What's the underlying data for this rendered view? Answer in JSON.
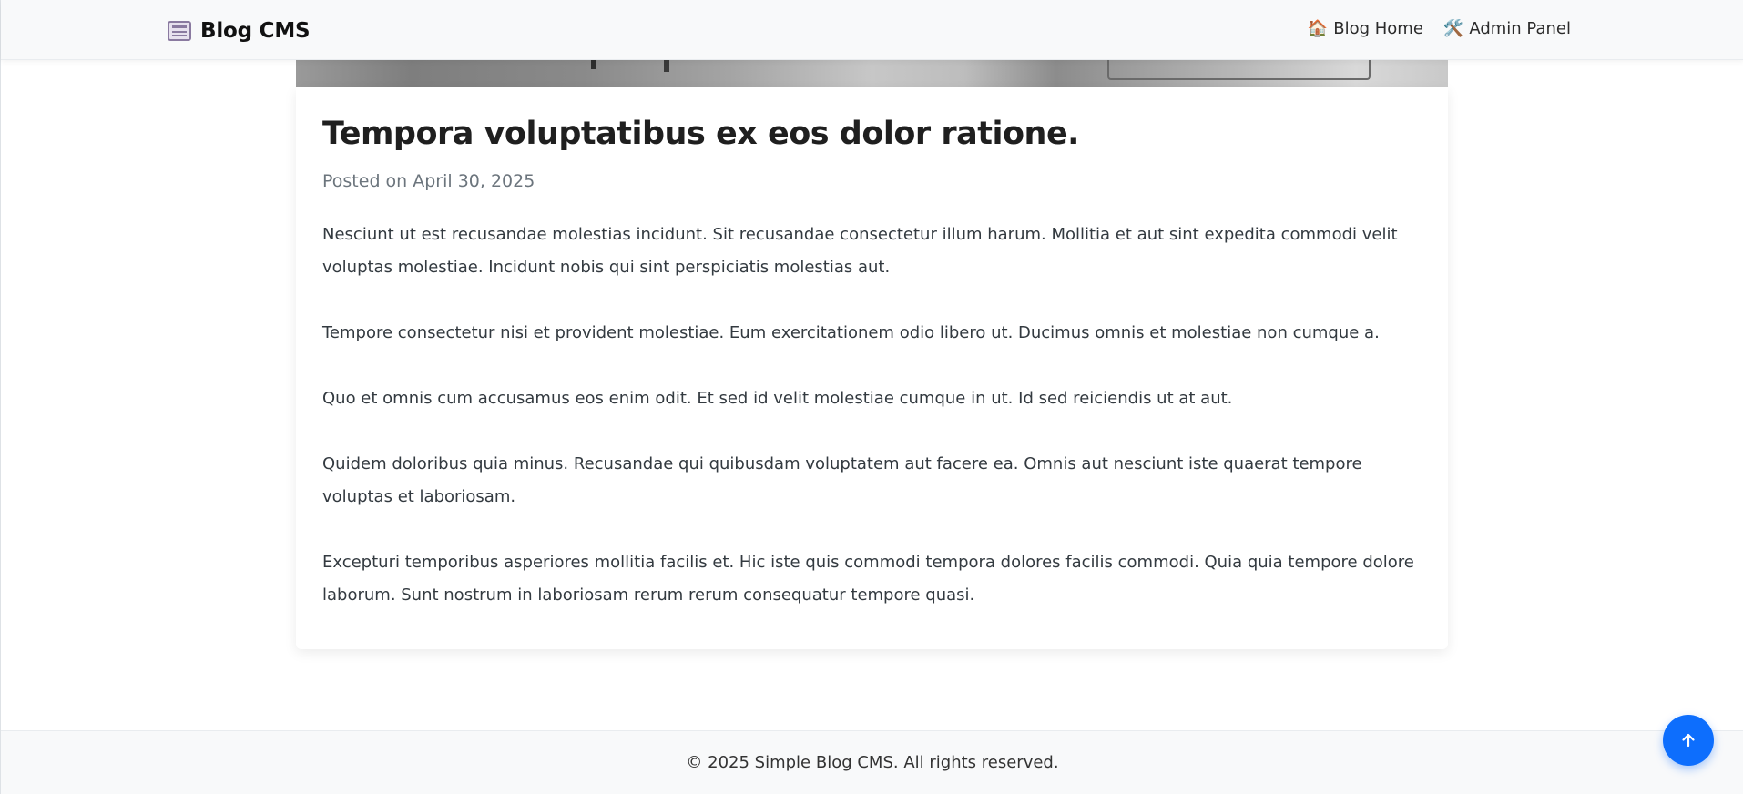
{
  "navbar": {
    "brand_icon": "newspaper-icon",
    "brand_text": "Blog CMS",
    "links": [
      {
        "icon": "house-icon",
        "glyph": "🏠",
        "label": "Blog Home"
      },
      {
        "icon": "tools-icon",
        "glyph": "🛠️",
        "label": "Admin Panel"
      }
    ]
  },
  "post": {
    "title": "Tempora voluptatibus ex eos dolor ratione.",
    "meta": "Posted on April 30, 2025",
    "paragraphs": [
      "Nesciunt ut est recusandae molestias incidunt. Sit recusandae consectetur illum harum. Mollitia et aut sint expedita commodi velit voluptas molestiae. Incidunt nobis qui sint perspiciatis molestias aut.",
      "Tempore consectetur nisi et provident molestiae. Eum exercitationem odio libero ut. Ducimus omnis et molestiae non cumque a.",
      "Quo et omnis cum accusamus eos enim odit. Et sed id velit molestiae cumque in ut. Id sed reiciendis ut at aut.",
      "Quidem doloribus quia minus. Recusandae qui quibusdam voluptatem aut facere ea. Omnis aut nesciunt iste quaerat tempore voluptas et laboriosam.",
      "Excepturi temporibus asperiores mollitia facilis et. Hic iste quis commodi tempora dolores facilis commodi. Quia quia tempore dolore laborum. Sunt nostrum in laboriosam rerum rerum consequatur tempore quasi."
    ]
  },
  "footer": {
    "text": "© 2025 Simple Blog CMS. All rights reserved."
  },
  "back_to_top": {
    "icon": "arrow-up-icon",
    "color": "#0d6efd"
  }
}
